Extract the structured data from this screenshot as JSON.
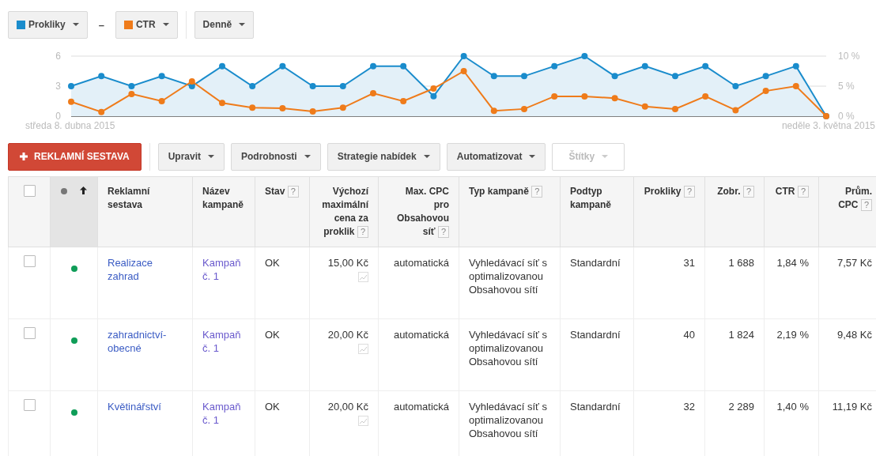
{
  "metric_bar": {
    "separator": "–",
    "interval": "Denně"
  },
  "chart": {
    "chart_data": {
      "type": "line",
      "categories": [
        "středa 8. dubna 2015",
        null,
        null,
        null,
        null,
        null,
        null,
        null,
        null,
        null,
        null,
        null,
        null,
        null,
        null,
        null,
        null,
        null,
        null,
        null,
        null,
        null,
        null,
        null,
        null,
        "neděle 3. května 2015"
      ],
      "ylim": [
        0,
        6
      ],
      "yticks": [
        0,
        3,
        6
      ],
      "y2lim": [
        0,
        10
      ],
      "y2ticks": [
        {
          "value": 0,
          "label": "0 %"
        },
        {
          "value": 5,
          "label": "5 %"
        },
        {
          "value": 10,
          "label": "10 %"
        }
      ],
      "series": [
        {
          "name": "Prokliky",
          "color": "#1a8ccc",
          "marker": "circle",
          "values": [
            3,
            4,
            3,
            4,
            3,
            5,
            3,
            5,
            3,
            3,
            5,
            5,
            2,
            6,
            4,
            4,
            5,
            6,
            4,
            5,
            4,
            5,
            3,
            4,
            5,
            0
          ]
        },
        {
          "name": "CTR",
          "color": "#ef7b1a",
          "axis": "y2",
          "marker": "circle",
          "values": [
            2.4,
            0.7,
            3.7,
            2.5,
            5.8,
            2.2,
            1.4,
            1.3,
            0.8,
            1.4,
            3.8,
            2.5,
            4.6,
            7.5,
            0.9,
            1.2,
            3.3,
            3.3,
            3.0,
            1.6,
            1.2,
            3.3,
            1.0,
            4.2,
            5.0,
            0
          ]
        }
      ]
    }
  },
  "action_bar": {
    "add_button": "REKLAMNÍ SESTAVA",
    "menus": [
      {
        "label": "Upravit",
        "disabled": false
      },
      {
        "label": "Podrobnosti",
        "disabled": false
      },
      {
        "label": "Strategie nabídek",
        "disabled": false
      },
      {
        "label": "Automatizovat",
        "disabled": false
      },
      {
        "label": "Štítky",
        "disabled": true
      }
    ]
  },
  "table": {
    "select_all": {
      "checked": false
    },
    "status_column": {
      "sorted": true
    },
    "columns": [
      {
        "label": "Reklamní sestava",
        "kind": "text"
      },
      {
        "label": "Název kampaně",
        "kind": "text"
      },
      {
        "label": "Stav",
        "help": "?",
        "kind": "text"
      },
      {
        "label": "Výchozí maximální cena za proklik",
        "help": "?",
        "kind": "number"
      },
      {
        "label": "Max. CPC pro Obsahovou síť",
        "help": "?",
        "kind": "number"
      },
      {
        "label": "Typ kampaně",
        "help": "?",
        "kind": "text"
      },
      {
        "label": "Podtyp kampaně",
        "kind": "text"
      },
      {
        "label": "Prokliky",
        "help": "?",
        "kind": "number"
      },
      {
        "label": "Zobr.",
        "help": "?",
        "kind": "number"
      },
      {
        "label": "CTR",
        "help": "?",
        "kind": "number"
      },
      {
        "label": "Prům. CPC",
        "help": "?",
        "kind": "number"
      }
    ],
    "rows": [
      {
        "checked": false,
        "color": "#0f9d58",
        "ad_group": "Realizace zahrad",
        "campaign": "Kampaň č. 1",
        "status": "OK",
        "default_bid": "15,00 Kč",
        "display_cpc": "automatická",
        "campaign_type": "Vyhledávací síť s optimalizovanou Obsahovou sítí",
        "subtype": "Standardní",
        "clicks": "31",
        "impressions": "1 688",
        "ctr": "1,84 %",
        "avg_cpc": "7,57 Kč"
      },
      {
        "checked": false,
        "color": "#0f9d58",
        "ad_group": "zahradnictví-obecné",
        "campaign": "Kampaň č. 1",
        "status": "OK",
        "default_bid": "20,00 Kč",
        "display_cpc": "automatická",
        "campaign_type": "Vyhledávací síť s optimalizovanou Obsahovou sítí",
        "subtype": "Standardní",
        "clicks": "40",
        "impressions": "1 824",
        "ctr": "2,19 %",
        "avg_cpc": "9,48 Kč"
      },
      {
        "checked": false,
        "color": "#0f9d58",
        "ad_group": "Květinářství",
        "campaign": "Kampaň č. 1",
        "status": "OK",
        "default_bid": "20,00 Kč",
        "display_cpc": "automatická",
        "campaign_type": "Vyhledávací síť s optimalizovanou Obsahovou sítí",
        "subtype": "Standardní",
        "clicks": "32",
        "impressions": "2 289",
        "ctr": "1,40 %",
        "avg_cpc": "11,19 Kč"
      }
    ]
  }
}
